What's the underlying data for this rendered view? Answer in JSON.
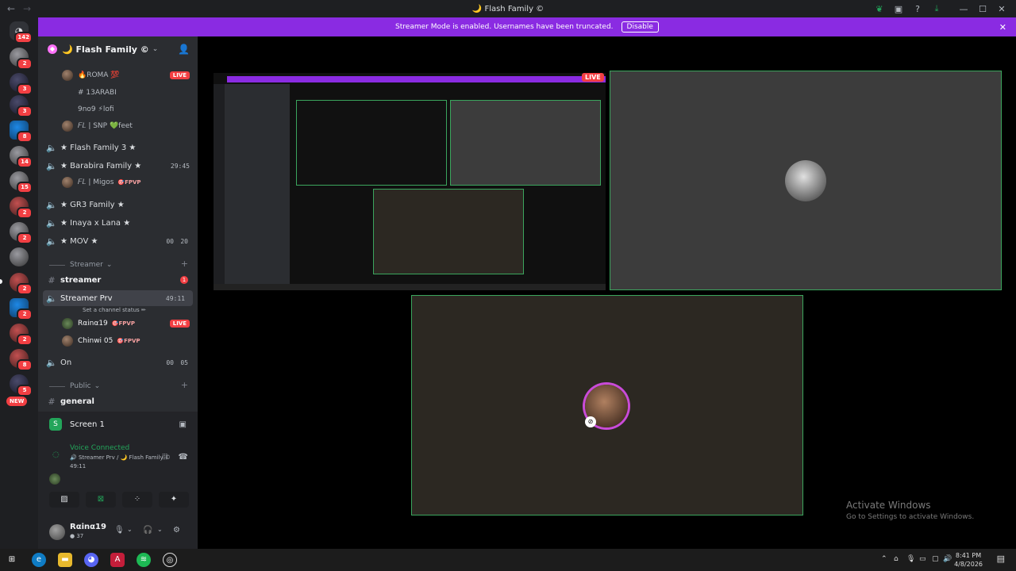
{
  "window": {
    "title": "🌙 Flash Family ©"
  },
  "banner": {
    "text": "Streamer Mode is enabled. Usernames have been truncated.",
    "button": "Disable"
  },
  "servers": {
    "home_badge": "142",
    "new_badge": "NEW",
    "badges": [
      "2",
      "3",
      "3",
      "8",
      "14",
      "15",
      "2",
      "2",
      "2",
      "2",
      "2",
      "8",
      "5"
    ]
  },
  "guild": {
    "name": "🌙 Flash Family ©"
  },
  "channels": {
    "users_top": [
      {
        "name": "🔥ROMA 💯",
        "live": "LIVE"
      },
      {
        "name": "# 13ARABI"
      },
      {
        "name": "9no9 ⚡lofi"
      },
      {
        "name": "𝐹𝐿 | SNP 💚feet"
      }
    ],
    "voice1": {
      "name": "★ Flash Family 3 ★"
    },
    "voice2": {
      "name": "★ Barabira Family ★",
      "time": "29:45"
    },
    "voice2_user": {
      "name": "𝐹𝐿 | Migos",
      "tag": "🎯FPVP"
    },
    "voice3": {
      "name": "★ GR3 Family ★"
    },
    "voice4": {
      "name": "★ Inaya x Lana ★"
    },
    "voice5": {
      "name": "★ MOV ★",
      "count_a": "00",
      "count_b": "20"
    },
    "cat_streamer": "Streamer",
    "text_streamer": {
      "name": "streamer",
      "unread": "1"
    },
    "voice_prv": {
      "name": "Streamer Prv",
      "time": "49:11",
      "status": "Set a channel status ✏"
    },
    "prv_users": [
      {
        "name": "Rαinα19",
        "tag": "🎯FPVP",
        "live": "LIVE"
      },
      {
        "name": "Chinwi 05",
        "tag": "🎯FPVP"
      }
    ],
    "voice_on": {
      "name": "On",
      "count_a": "00",
      "count_b": "05"
    },
    "cat_public": "Public",
    "text_general": {
      "name": "general"
    }
  },
  "screen_share": {
    "label": "Screen 1"
  },
  "voice_panel": {
    "status": "Voice Connected",
    "location": "🔊 Streamer Prv / 🌙 Flash Family ©",
    "time": "49:11"
  },
  "user_panel": {
    "name": "Rαinα19",
    "status": "● 37"
  },
  "stage": {
    "live": "LIVE",
    "watermark_title": "Activate Windows",
    "watermark_sub": "Go to Settings to activate Windows."
  },
  "taskbar": {
    "time": "8:41 PM",
    "date": "4/8/2026"
  },
  "colors": {
    "accent_banner": "#8a2be2",
    "live": "#f23f43",
    "voice_green": "#23a55a",
    "tile_border": "#3ba55d"
  }
}
